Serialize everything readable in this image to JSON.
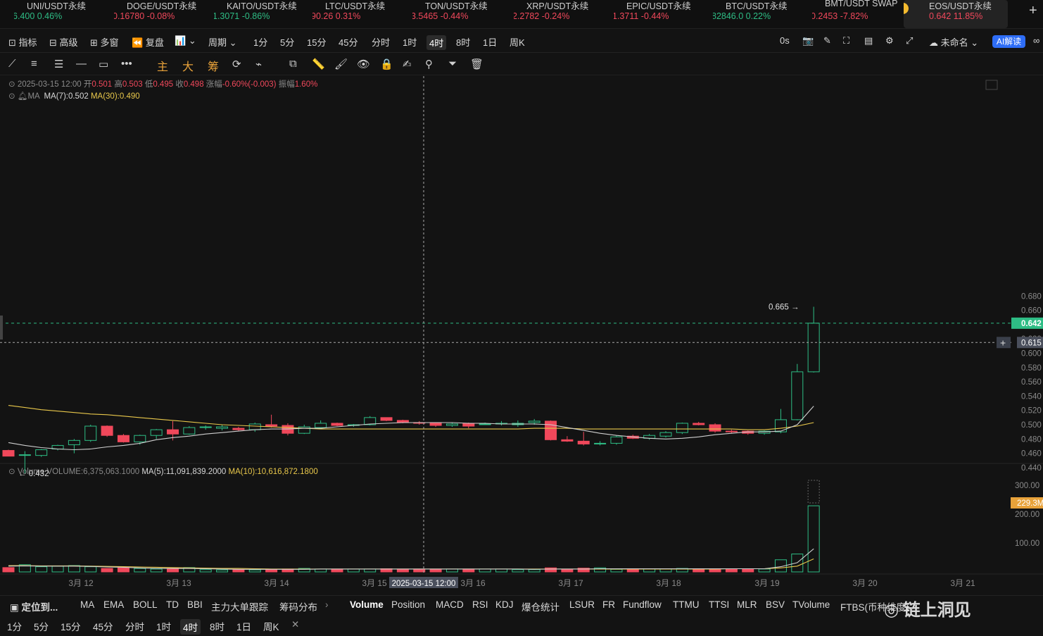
{
  "ticker": [
    {
      "name": "UNI/USDT永续",
      "price": "6.400",
      "change": "0.46%",
      "dir": "up"
    },
    {
      "name": "DOGE/USDT永续",
      "price": "0.16780",
      "change": "-0.08%",
      "dir": "dn"
    },
    {
      "name": "KAITO/USDT永续",
      "price": "1.3071",
      "change": "-0.86%",
      "dir": "up"
    },
    {
      "name": "LTC/USDT永续",
      "price": "90.26",
      "change": "0.31%",
      "dir": "dn"
    },
    {
      "name": "TON/USDT永续",
      "price": "3.5465",
      "change": "-0.44%",
      "dir": "dn"
    },
    {
      "name": "XRP/USDT永续",
      "price": "2.2782",
      "change": "-0.24%",
      "dir": "dn"
    },
    {
      "name": "EPIC/USDT永续",
      "price": "1.3711",
      "change": "-0.44%",
      "dir": "dn"
    },
    {
      "name": "BTC/USDT永续",
      "price": "82846.0",
      "change": "0.22%",
      "dir": "up"
    },
    {
      "name": "BMT/USDT SWAP",
      "price": "0.2453",
      "change": "-7.82%",
      "dir": "dn"
    },
    {
      "name": "EOS/USDT永续",
      "price": "0.642",
      "change": "11.85%",
      "dir": "dn",
      "active": true
    }
  ],
  "toolbar": {
    "indicators": "指标",
    "advanced": "高级",
    "multi": "多窗",
    "replay": "复盘",
    "period": "周期",
    "timeframes": [
      "1分",
      "5分",
      "15分",
      "45分",
      "分时",
      "1时",
      "4时",
      "8时",
      "1日",
      "周K"
    ],
    "selected_tf": "4时",
    "countdown": "0s",
    "layout_name": "未命名",
    "ai": "AI解读"
  },
  "drawbar": {
    "main": "主",
    "big": "大",
    "chip": "筹"
  },
  "legend": {
    "date": "2025-03-15 12:00",
    "open_label": "开",
    "open": "0.501",
    "high_label": "高",
    "high": "0.503",
    "low_label": "低",
    "low": "0.495",
    "close_label": "收",
    "close": "0.498",
    "change_label": "涨幅",
    "change": "-0.60%(-0.003)",
    "amp_label": "振幅",
    "amp": "1.60%",
    "ma_label": "MA",
    "ma7": "MA(7):0.502",
    "ma30": "MA(30):0.490"
  },
  "vol_legend": {
    "label": "Volume",
    "vol": "VOLUME:6,375,063.1000",
    "ma5": "MA(5):11,091,839.2000",
    "ma10": "MA(10):10,616,872.1800"
  },
  "colors": {
    "up": "#2ebd85",
    "down": "#f0485b",
    "ma7": "#cfcfcf",
    "ma30": "#e9c84b",
    "bg": "#131313"
  },
  "chart_data": {
    "type": "candlestick",
    "timeframe": "4时",
    "ylim": [
      0.43,
      0.685
    ],
    "y_ticks": [
      "0.680",
      "0.660",
      "0.620",
      "0.600",
      "0.580",
      "0.560",
      "0.540",
      "0.520",
      "0.500",
      "0.480",
      "0.460",
      "0.440"
    ],
    "last_price": "0.642",
    "crosshair_price": "0.615",
    "crosshair_time": "2025-03-15 12:00",
    "high_marker": "0.665",
    "low_marker": "0.432",
    "x_labels": [
      "3月 12",
      "3月 13",
      "3月 14",
      "3月 15",
      "3月 16",
      "3月 17",
      "3月 18",
      "3月 19",
      "3月 20",
      "3月 21"
    ],
    "candles": [
      {
        "o": 0.464,
        "h": 0.465,
        "l": 0.456,
        "c": 0.456
      },
      {
        "o": 0.457,
        "h": 0.463,
        "l": 0.432,
        "c": 0.458
      },
      {
        "o": 0.457,
        "h": 0.466,
        "l": 0.455,
        "c": 0.465
      },
      {
        "o": 0.466,
        "h": 0.472,
        "l": 0.464,
        "c": 0.471
      },
      {
        "o": 0.472,
        "h": 0.48,
        "l": 0.46,
        "c": 0.478
      },
      {
        "o": 0.478,
        "h": 0.5,
        "l": 0.476,
        "c": 0.498
      },
      {
        "o": 0.498,
        "h": 0.499,
        "l": 0.483,
        "c": 0.485
      },
      {
        "o": 0.485,
        "h": 0.487,
        "l": 0.475,
        "c": 0.476
      },
      {
        "o": 0.476,
        "h": 0.486,
        "l": 0.472,
        "c": 0.485
      },
      {
        "o": 0.485,
        "h": 0.494,
        "l": 0.48,
        "c": 0.493
      },
      {
        "o": 0.493,
        "h": 0.505,
        "l": 0.478,
        "c": 0.487
      },
      {
        "o": 0.487,
        "h": 0.498,
        "l": 0.486,
        "c": 0.496
      },
      {
        "o": 0.496,
        "h": 0.499,
        "l": 0.493,
        "c": 0.497
      },
      {
        "o": 0.495,
        "h": 0.5,
        "l": 0.492,
        "c": 0.497
      },
      {
        "o": 0.495,
        "h": 0.497,
        "l": 0.491,
        "c": 0.493
      },
      {
        "o": 0.493,
        "h": 0.503,
        "l": 0.49,
        "c": 0.501
      },
      {
        "o": 0.5,
        "h": 0.514,
        "l": 0.496,
        "c": 0.498
      },
      {
        "o": 0.499,
        "h": 0.502,
        "l": 0.485,
        "c": 0.488
      },
      {
        "o": 0.488,
        "h": 0.5,
        "l": 0.487,
        "c": 0.497
      },
      {
        "o": 0.496,
        "h": 0.506,
        "l": 0.494,
        "c": 0.502
      },
      {
        "o": 0.502,
        "h": 0.503,
        "l": 0.498,
        "c": 0.499
      },
      {
        "o": 0.499,
        "h": 0.501,
        "l": 0.497,
        "c": 0.5
      },
      {
        "o": 0.5,
        "h": 0.512,
        "l": 0.499,
        "c": 0.51
      },
      {
        "o": 0.51,
        "h": 0.51,
        "l": 0.505,
        "c": 0.506
      },
      {
        "o": 0.506,
        "h": 0.507,
        "l": 0.502,
        "c": 0.503
      },
      {
        "o": 0.503,
        "h": 0.505,
        "l": 0.5,
        "c": 0.502
      },
      {
        "o": 0.502,
        "h": 0.502,
        "l": 0.497,
        "c": 0.499
      },
      {
        "o": 0.499,
        "h": 0.503,
        "l": 0.497,
        "c": 0.501
      },
      {
        "o": 0.502,
        "h": 0.503,
        "l": 0.495,
        "c": 0.498
      },
      {
        "o": 0.501,
        "h": 0.503,
        "l": 0.5,
        "c": 0.501
      },
      {
        "o": 0.501,
        "h": 0.505,
        "l": 0.499,
        "c": 0.502
      },
      {
        "o": 0.5,
        "h": 0.506,
        "l": 0.497,
        "c": 0.502
      },
      {
        "o": 0.503,
        "h": 0.508,
        "l": 0.5,
        "c": 0.505
      },
      {
        "o": 0.505,
        "h": 0.506,
        "l": 0.478,
        "c": 0.479
      },
      {
        "o": 0.479,
        "h": 0.484,
        "l": 0.476,
        "c": 0.477
      },
      {
        "o": 0.477,
        "h": 0.49,
        "l": 0.471,
        "c": 0.473
      },
      {
        "o": 0.474,
        "h": 0.477,
        "l": 0.471,
        "c": 0.474
      },
      {
        "o": 0.474,
        "h": 0.485,
        "l": 0.472,
        "c": 0.483
      },
      {
        "o": 0.484,
        "h": 0.486,
        "l": 0.48,
        "c": 0.481
      },
      {
        "o": 0.481,
        "h": 0.487,
        "l": 0.479,
        "c": 0.485
      },
      {
        "o": 0.484,
        "h": 0.491,
        "l": 0.482,
        "c": 0.489
      },
      {
        "o": 0.489,
        "h": 0.503,
        "l": 0.487,
        "c": 0.502
      },
      {
        "o": 0.502,
        "h": 0.504,
        "l": 0.499,
        "c": 0.5
      },
      {
        "o": 0.5,
        "h": 0.502,
        "l": 0.489,
        "c": 0.491
      },
      {
        "o": 0.491,
        "h": 0.493,
        "l": 0.488,
        "c": 0.49
      },
      {
        "o": 0.491,
        "h": 0.492,
        "l": 0.486,
        "c": 0.488
      },
      {
        "o": 0.488,
        "h": 0.492,
        "l": 0.486,
        "c": 0.491
      },
      {
        "o": 0.49,
        "h": 0.522,
        "l": 0.488,
        "c": 0.507
      },
      {
        "o": 0.507,
        "h": 0.585,
        "l": 0.506,
        "c": 0.574
      },
      {
        "o": 0.574,
        "h": 0.665,
        "l": 0.573,
        "c": 0.642
      }
    ],
    "ma7": [
      0.475,
      0.471,
      0.468,
      0.466,
      0.465,
      0.466,
      0.469,
      0.471,
      0.474,
      0.479,
      0.482,
      0.484,
      0.487,
      0.489,
      0.491,
      0.493,
      0.494,
      0.494,
      0.495,
      0.495,
      0.497,
      0.499,
      0.501,
      0.502,
      0.503,
      0.503,
      0.503,
      0.503,
      0.502,
      0.502,
      0.501,
      0.501,
      0.501,
      0.5,
      0.496,
      0.492,
      0.488,
      0.485,
      0.483,
      0.481,
      0.48,
      0.481,
      0.483,
      0.486,
      0.488,
      0.49,
      0.49,
      0.491,
      0.5,
      0.526
    ],
    "ma30": [
      0.527,
      0.524,
      0.521,
      0.519,
      0.517,
      0.515,
      0.514,
      0.512,
      0.51,
      0.508,
      0.506,
      0.504,
      0.502,
      0.5,
      0.499,
      0.498,
      0.497,
      0.496,
      0.495,
      0.494,
      0.494,
      0.494,
      0.494,
      0.494,
      0.494,
      0.494,
      0.494,
      0.494,
      0.494,
      0.494,
      0.494,
      0.494,
      0.495,
      0.495,
      0.495,
      0.494,
      0.494,
      0.494,
      0.494,
      0.494,
      0.494,
      0.494,
      0.494,
      0.494,
      0.494,
      0.493,
      0.493,
      0.495,
      0.498,
      0.503
    ],
    "volume_ticks": [
      "300.00",
      "200.00",
      "100.00"
    ],
    "volume_last_label": "229.3M",
    "volume_max_m": 320,
    "volumes_m": [
      15,
      25,
      18,
      20,
      22,
      18,
      12,
      14,
      12,
      10,
      10,
      15,
      8,
      7,
      7,
      7,
      8,
      10,
      12,
      10,
      10,
      10,
      10,
      11,
      10,
      10,
      10,
      10,
      10,
      10,
      10,
      8,
      8,
      14,
      9,
      13,
      14,
      9,
      11,
      11,
      10,
      12,
      11,
      11,
      10,
      10,
      10,
      42,
      62,
      229
    ],
    "vol_ma5_m": [
      20,
      21,
      20,
      20,
      20,
      19,
      17,
      16,
      14,
      12,
      12,
      12,
      11,
      10,
      9,
      9,
      9,
      9,
      9,
      10,
      10,
      10,
      10,
      10,
      10,
      10,
      10,
      10,
      10,
      10,
      10,
      10,
      9,
      10,
      10,
      10,
      11,
      11,
      11,
      11,
      11,
      11,
      11,
      11,
      11,
      11,
      11,
      18,
      32,
      80
    ],
    "vol_ma10_m": [
      22,
      22,
      21,
      21,
      21,
      20,
      19,
      18,
      17,
      16,
      15,
      14,
      13,
      12,
      12,
      11,
      10,
      10,
      10,
      10,
      10,
      10,
      10,
      10,
      10,
      10,
      10,
      10,
      10,
      10,
      10,
      10,
      10,
      10,
      10,
      10,
      10,
      10,
      10,
      10,
      10,
      10,
      10,
      10,
      11,
      11,
      11,
      14,
      20,
      45
    ]
  },
  "indicator_bar": {
    "locate": "定位到...",
    "main": [
      "MA",
      "EMA",
      "BOLL",
      "TD",
      "BBI",
      "主力大单跟踪",
      "筹码分布"
    ],
    "sub": [
      "Volume",
      "Position",
      "MACD",
      "RSI",
      "KDJ",
      "爆仓统计",
      "LSUR",
      "FR",
      "Fundflow",
      "TTMU",
      "TTSI",
      "MLR",
      "BSV",
      "TVolume",
      "FTBS(币种维度)"
    ]
  },
  "bottom_tfs": [
    "1分",
    "5分",
    "15分",
    "45分",
    "分时",
    "1时",
    "4时",
    "8时",
    "1日",
    "周K"
  ],
  "watermark": "链上洞见"
}
